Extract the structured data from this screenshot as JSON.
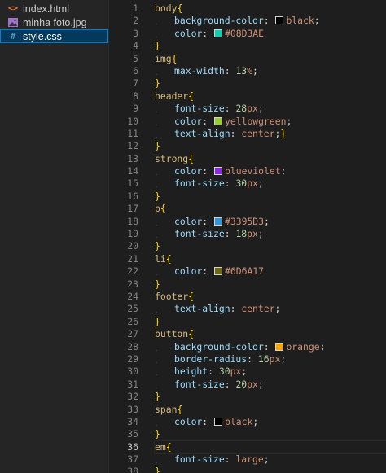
{
  "explorer": {
    "files": [
      {
        "name": "index.html",
        "icon": "html-file-icon",
        "active": false
      },
      {
        "name": "minha foto.jpg",
        "icon": "image-file-icon",
        "active": false
      },
      {
        "name": "style.css",
        "icon": "css-file-icon",
        "active": true
      }
    ]
  },
  "editor": {
    "current_line": 36,
    "lines": [
      {
        "n": "1",
        "text": "body{"
      },
      {
        "n": "2",
        "text": "    background-color: black;"
      },
      {
        "n": "3",
        "text": "    color: #08D3AE"
      },
      {
        "n": "4",
        "text": "}"
      },
      {
        "n": "5",
        "text": "img{"
      },
      {
        "n": "6",
        "text": "    max-width: 13%;"
      },
      {
        "n": "7",
        "text": "}"
      },
      {
        "n": "8",
        "text": "header{"
      },
      {
        "n": "9",
        "text": "    font-size: 28px;"
      },
      {
        "n": "10",
        "text": "    color: yellowgreen;"
      },
      {
        "n": "11",
        "text": "    text-align: center;}"
      },
      {
        "n": "12",
        "text": "}"
      },
      {
        "n": "13",
        "text": "strong{"
      },
      {
        "n": "14",
        "text": "    color: blueviolet;"
      },
      {
        "n": "15",
        "text": "    font-size: 30px;"
      },
      {
        "n": "16",
        "text": "}"
      },
      {
        "n": "17",
        "text": "p{"
      },
      {
        "n": "18",
        "text": "    color: #3395D3;"
      },
      {
        "n": "19",
        "text": "    font-size: 18px;"
      },
      {
        "n": "20",
        "text": "}"
      },
      {
        "n": "21",
        "text": "li{"
      },
      {
        "n": "22",
        "text": "    color: #6D6A17"
      },
      {
        "n": "23",
        "text": "}"
      },
      {
        "n": "24",
        "text": "footer{"
      },
      {
        "n": "25",
        "text": "    text-align: center;"
      },
      {
        "n": "26",
        "text": "}"
      },
      {
        "n": "27",
        "text": "button{"
      },
      {
        "n": "28",
        "text": "    background-color: orange;"
      },
      {
        "n": "29",
        "text": "    border-radius: 16px;"
      },
      {
        "n": "30",
        "text": "    height: 30px;"
      },
      {
        "n": "31",
        "text": "    font-size: 20px;"
      },
      {
        "n": "32",
        "text": "}"
      },
      {
        "n": "33",
        "text": "span{"
      },
      {
        "n": "34",
        "text": "    color: black;"
      },
      {
        "n": "35",
        "text": "}"
      },
      {
        "n": "36",
        "text": "em{"
      },
      {
        "n": "37",
        "text": "    font-size: large;"
      },
      {
        "n": "38",
        "text": "}"
      }
    ],
    "swatch_colors": {
      "black": "#000000",
      "#08D3AE": "#08D3AE",
      "yellowgreen": "#9acd32",
      "blueviolet": "#8a2be2",
      "#3395D3": "#3395D3",
      "#6D6A17": "#6D6A17",
      "orange": "#ffa500"
    }
  },
  "theme": {
    "editor_bg": "#1e1e1e",
    "sidebar_bg": "#252526",
    "active_file_bg": "#04395e",
    "selector_color": "#d7ba7d",
    "property_color": "#9cdcfe",
    "value_color": "#ce9178",
    "number_color": "#b5cea8",
    "brace_color": "#ffd700"
  }
}
